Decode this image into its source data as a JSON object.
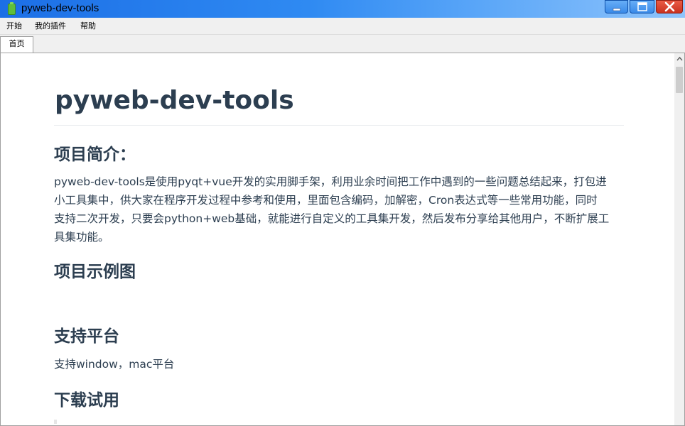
{
  "window": {
    "title": "pyweb-dev-tools",
    "icon": "app-battery-icon"
  },
  "menu": {
    "items": [
      "开始",
      "我的插件",
      "帮助"
    ]
  },
  "tabs": [
    {
      "label": "首页",
      "active": true
    }
  ],
  "doc": {
    "title": "pyweb-dev-tools",
    "sections": [
      {
        "heading": "项目简介：",
        "lines": [
          "pyweb-dev-tools是使用pyqt+vue开发的实用脚手架，利用业余时间把工作中遇到的一些问题总结起来，打包进",
          "小工具集中，供大家在程序开发过程中参考和使用，里面包含编码，加解密，Cron表达式等一些常用功能，同时",
          "支持二次开发，只要会python+web基础，就能进行自定义的工具集开发，然后发布分享给其他用户，不断扩展工",
          "具集功能。"
        ]
      },
      {
        "heading": "项目示例图"
      },
      {
        "heading": "支持平台",
        "text": "支持window，mac平台"
      },
      {
        "heading": "下载试用"
      }
    ]
  },
  "colors": {
    "titlebar_start": "#1c6fe6",
    "close_button": "#d4402b",
    "text": "#2c3e50"
  }
}
